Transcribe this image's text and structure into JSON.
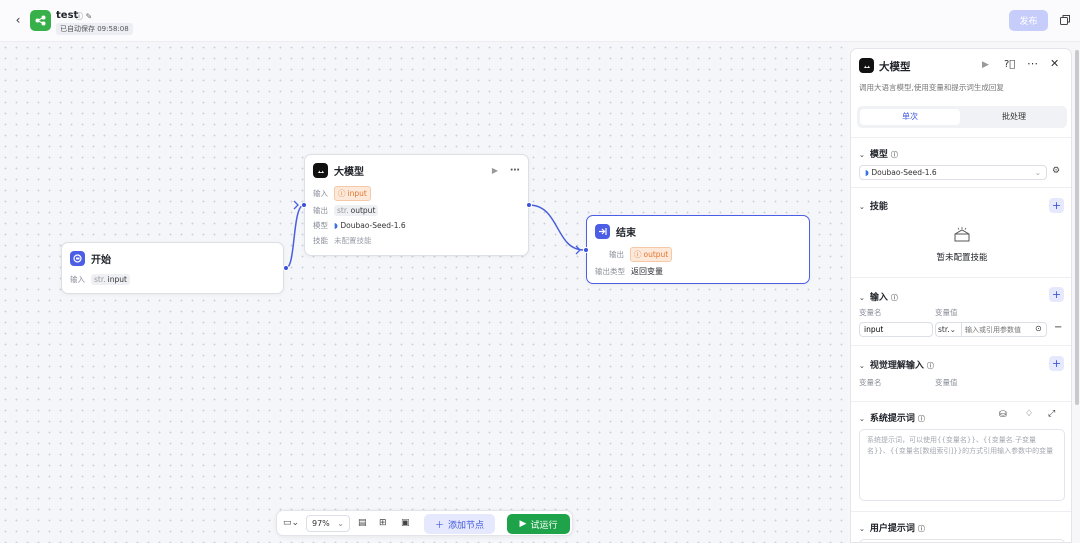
{
  "topbar": {
    "back_icon": "chevron-left",
    "app_name": "test",
    "autosave": "已自动保存 09:58:08",
    "publish_label": "发布"
  },
  "nodes": {
    "start": {
      "title": "开始",
      "rows": [
        {
          "key": "输入",
          "prefix": "str.",
          "value": "input"
        }
      ]
    },
    "llm": {
      "title": "大模型",
      "input_key": "输入",
      "input_value": "input",
      "output_key": "输出",
      "output_prefix": "str.",
      "output_value": "output",
      "model_key": "模型",
      "model_value": "Doubao-Seed-1.6",
      "skill_key": "技能",
      "skill_value": "未配置技能"
    },
    "end": {
      "title": "结束",
      "output_key": "输出",
      "output_value": "output",
      "output_type_key": "输出类型",
      "output_type_value": "返回变量"
    }
  },
  "toolbar": {
    "zoom": "97%",
    "add_node_label": "添加节点",
    "run_label": "试运行"
  },
  "panel": {
    "title": "大模型",
    "description": "调用大语言模型,使用变量和提示词生成回复",
    "tabs": [
      "单次",
      "批处理"
    ],
    "active_tab": 0,
    "model_section": "模型",
    "model_value": "Doubao-Seed-1.6",
    "skills_section": "技能",
    "skills_empty": "暂未配置技能",
    "input_section": "输入",
    "var_name_header": "变量名",
    "var_value_header": "变量值",
    "input_var_name": "input",
    "input_var_type": "str.",
    "input_var_placeholder": "输入或引用参数值",
    "vision_section": "视觉理解输入",
    "vision_var_name_header": "变量名",
    "vision_var_value_header": "变量值",
    "system_prompt_section": "系统提示词",
    "system_prompt_placeholder": "系统提示词，可以使用{{变量名}}、{{变量名.子变量名}}、{{变量名[数组索引]}}的方式引用输入参数中的变量",
    "user_prompt_section": "用户提示词"
  },
  "colors": {
    "accent": "#3e57db",
    "run": "#1fa34a",
    "logo": "#37b04a",
    "publish_disabled": "#c7cdfb"
  }
}
